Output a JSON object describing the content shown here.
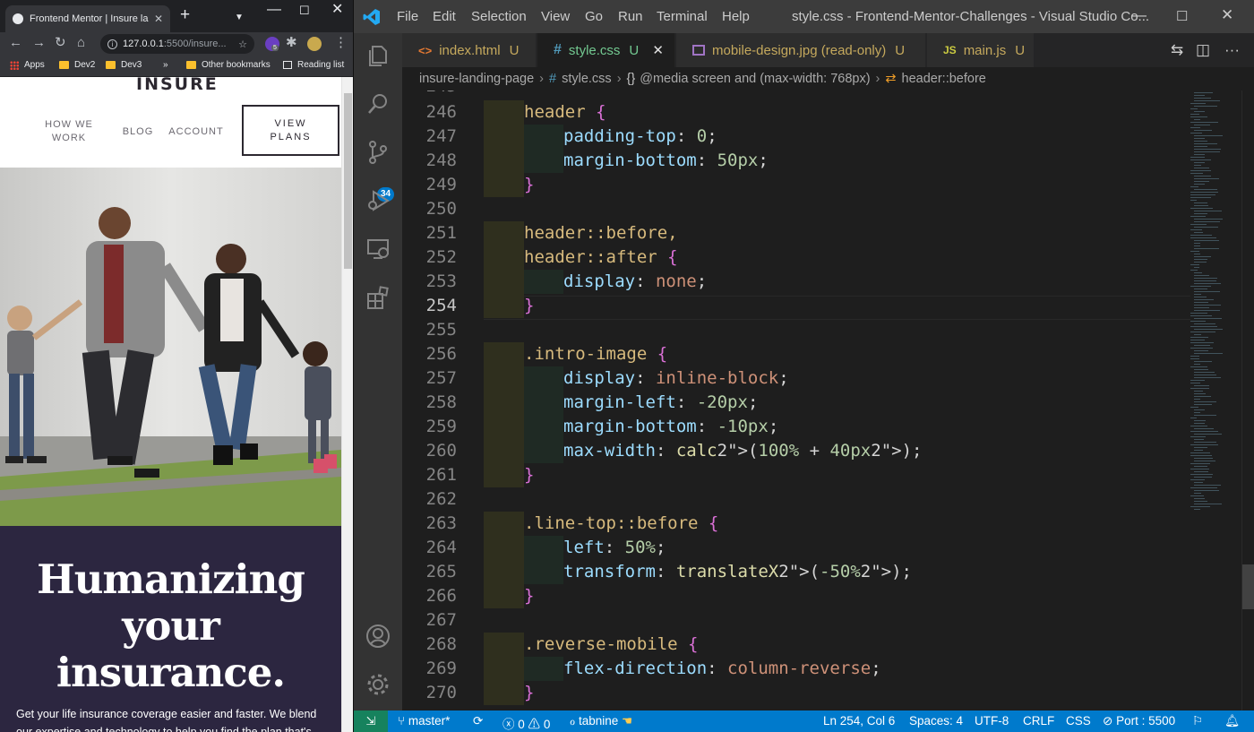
{
  "browser": {
    "tab_title": "Frontend Mentor | Insure landi",
    "new_tab": "+",
    "url_host": "127.0.0.1",
    "url_path": ":5500/insure...",
    "bookmarks": [
      "Apps",
      "Dev2",
      "Dev3",
      "»",
      "Other bookmarks",
      "Reading list"
    ],
    "ext_badge": "5",
    "site": {
      "logo": "INSURE",
      "nav": [
        "HOW WE WORK",
        "BLOG",
        "ACCOUNT"
      ],
      "cta": "VIEW PLANS",
      "hero_title": "Humanizing your insurance.",
      "hero_desc": "Get your life insurance coverage easier and faster. We blend our expertise and technology to help you find the plan that's"
    }
  },
  "vscode": {
    "menu": [
      "File",
      "Edit",
      "Selection",
      "View",
      "Go",
      "Run",
      "Terminal",
      "Help"
    ],
    "window_title": "style.css - Frontend-Mentor-Challenges - Visual Studio Co...",
    "tabs": [
      {
        "icon": "<>",
        "label": "index.html",
        "status": "U"
      },
      {
        "icon": "#",
        "label": "style.css",
        "status": "U",
        "active": true
      },
      {
        "icon": "img",
        "label": "mobile-design.jpg (read-only)",
        "status": "U"
      },
      {
        "icon": "JS",
        "label": "main.js",
        "status": "U"
      }
    ],
    "breadcrumbs": [
      "insure-landing-page",
      "style.css",
      "@media screen and (max-width: 768px)",
      "header::before"
    ],
    "scm_badge": "34",
    "lines": [
      {
        "n": 246,
        "indent": 0,
        "text": "header {"
      },
      {
        "n": 247,
        "indent": 1,
        "text": "padding-top: 0;"
      },
      {
        "n": 248,
        "indent": 1,
        "text": "margin-bottom: 50px;"
      },
      {
        "n": 249,
        "indent": 0,
        "text": "}"
      },
      {
        "n": 250,
        "indent": 0,
        "text": ""
      },
      {
        "n": 251,
        "indent": 0,
        "text": "header::before,"
      },
      {
        "n": 252,
        "indent": 0,
        "text": "header::after {"
      },
      {
        "n": 253,
        "indent": 1,
        "text": "display: none;"
      },
      {
        "n": 254,
        "indent": 0,
        "text": "}",
        "current": true
      },
      {
        "n": 255,
        "indent": 0,
        "text": ""
      },
      {
        "n": 256,
        "indent": 0,
        "text": ".intro-image {"
      },
      {
        "n": 257,
        "indent": 1,
        "text": "display: inline-block;"
      },
      {
        "n": 258,
        "indent": 1,
        "text": "margin-left: -20px;"
      },
      {
        "n": 259,
        "indent": 1,
        "text": "margin-bottom: -10px;"
      },
      {
        "n": 260,
        "indent": 1,
        "text": "max-width: calc(100% + 40px);"
      },
      {
        "n": 261,
        "indent": 0,
        "text": "}"
      },
      {
        "n": 262,
        "indent": 0,
        "text": ""
      },
      {
        "n": 263,
        "indent": 0,
        "text": ".line-top::before {"
      },
      {
        "n": 264,
        "indent": 1,
        "text": "left: 50%;"
      },
      {
        "n": 265,
        "indent": 1,
        "text": "transform: translateX(-50%);"
      },
      {
        "n": 266,
        "indent": 0,
        "text": "}"
      },
      {
        "n": 267,
        "indent": 0,
        "text": ""
      },
      {
        "n": 268,
        "indent": 0,
        "text": ".reverse-mobile {"
      },
      {
        "n": 269,
        "indent": 1,
        "text": "flex-direction: column-reverse;"
      },
      {
        "n": 270,
        "indent": 0,
        "text": "}"
      }
    ],
    "status": {
      "branch": "master*",
      "errors": "0",
      "warnings": "0",
      "tabnine": "tabnine",
      "position": "Ln 254, Col 6",
      "spaces": "Spaces: 4",
      "encoding": "UTF-8",
      "eol": "CRLF",
      "language": "CSS",
      "port": "Port : 5500"
    }
  },
  "colors": {
    "accent": "#007acc",
    "site_dark": "#2c2640",
    "untracked": "#73c991"
  }
}
